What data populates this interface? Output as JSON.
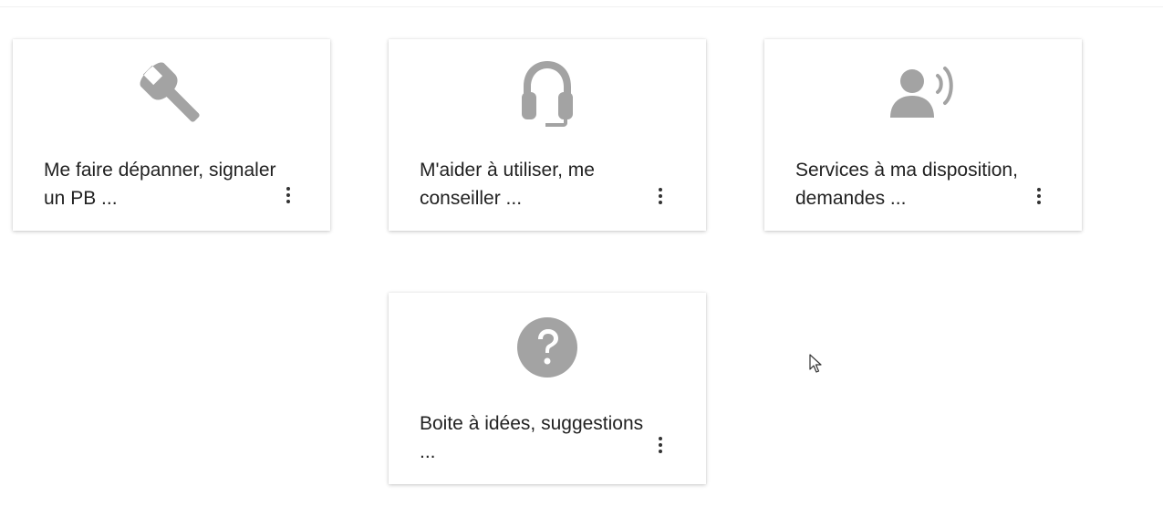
{
  "theme": {
    "icon_color": "#a3a3a3",
    "text_color": "#222222",
    "card_background": "#ffffff"
  },
  "tiles": [
    {
      "icon": "wrench-icon",
      "label": "Me faire dépanner, signaler un PB ..."
    },
    {
      "icon": "headset-icon",
      "label": "M'aider à utiliser, me conseiller ..."
    },
    {
      "icon": "person-speaking-icon",
      "label": "Services à ma disposition, demandes ..."
    },
    {
      "icon": "question-circle-icon",
      "label": "Boite à idées, suggestions ..."
    }
  ]
}
